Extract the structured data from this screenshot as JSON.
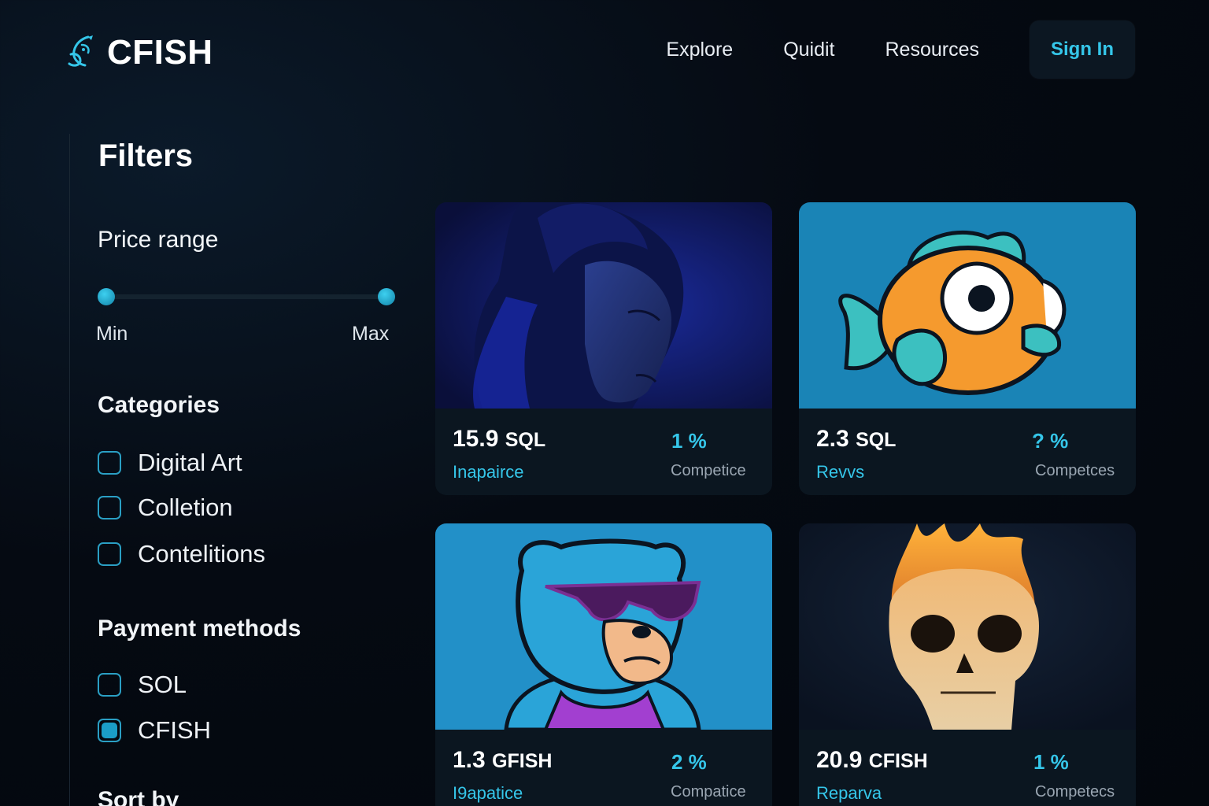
{
  "brand": {
    "name": "CFISH",
    "logo_icon": "fish-swirl-icon",
    "accent": "#35c6e9"
  },
  "nav": {
    "links": [
      "Explore",
      "Quidit",
      "Resources"
    ],
    "signin_label": "Sign In"
  },
  "filters": {
    "title": "Filters",
    "price_range": {
      "title": "Price range",
      "min_label": "Min",
      "max_label": "Max"
    },
    "categories": {
      "title": "Categories",
      "items": [
        {
          "label": "Digital Art",
          "checked": false
        },
        {
          "label": "Colletion",
          "checked": false
        },
        {
          "label": "Contelitions",
          "checked": false
        }
      ]
    },
    "payment_methods": {
      "title": "Payment methods",
      "items": [
        {
          "label": "SOL",
          "checked": false
        },
        {
          "label": "CFISH",
          "checked": true
        }
      ]
    },
    "sort_by": {
      "title": "Sort by"
    }
  },
  "cards": [
    {
      "image": "blue-woman-portrait",
      "price": "15.9",
      "unit": "SQL",
      "name": "Inapairce",
      "percent": "1 %",
      "subtext": "Competice"
    },
    {
      "image": "orange-fish",
      "price": "2.3",
      "unit": "SQL",
      "name": "Revvs",
      "percent": "? %",
      "subtext": "Competces"
    },
    {
      "image": "blue-bear-sunglasses",
      "price": "1.3",
      "unit": "GFISH",
      "name": "I9apatice",
      "percent": "2 %",
      "subtext": "Compatice"
    },
    {
      "image": "flaming-skull",
      "price": "20.9",
      "unit": "CFISH",
      "name": "Reparva",
      "percent": "1 %",
      "subtext": "Competecs"
    }
  ]
}
